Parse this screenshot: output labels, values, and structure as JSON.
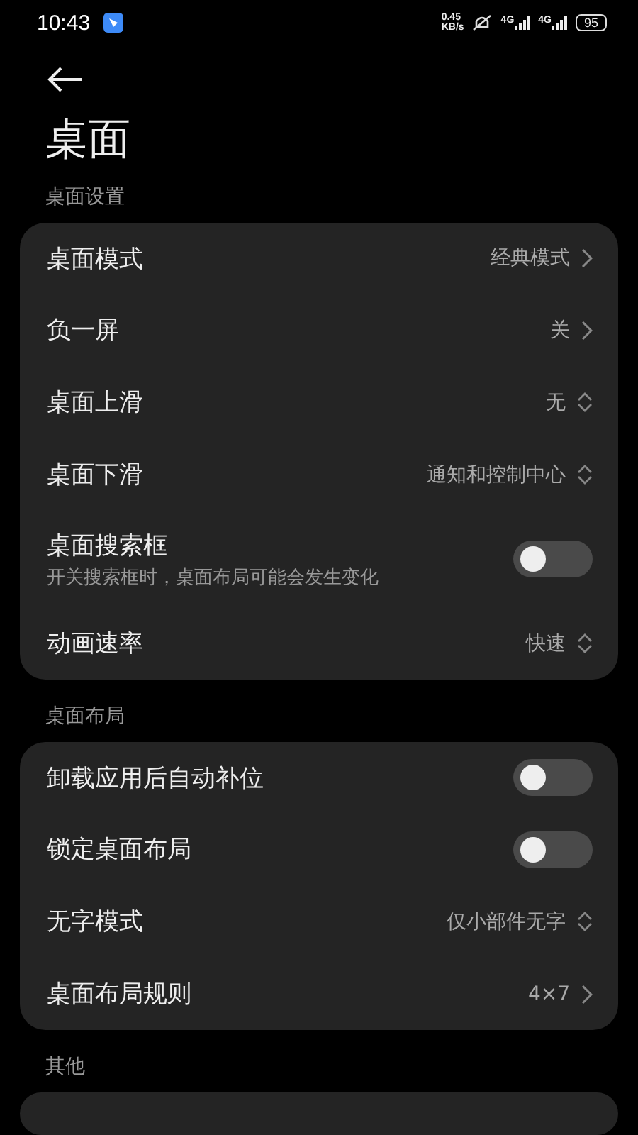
{
  "status_bar": {
    "time": "10:43",
    "speed_value": "0.45",
    "speed_unit": "KB/s",
    "signal_1": "4G",
    "signal_2": "4G",
    "battery": "95"
  },
  "header": {
    "title": "桌面"
  },
  "sections": [
    {
      "label": "桌面设置",
      "rows": [
        {
          "kind": "link",
          "title": "桌面模式",
          "value": "经典模式"
        },
        {
          "kind": "link",
          "title": "负一屏",
          "value": "关"
        },
        {
          "kind": "picker",
          "title": "桌面上滑",
          "value": "无"
        },
        {
          "kind": "picker",
          "title": "桌面下滑",
          "value": "通知和控制中心"
        },
        {
          "kind": "toggle",
          "title": "桌面搜索框",
          "subtitle": "开关搜索框时，桌面布局可能会发生变化",
          "on": false
        },
        {
          "kind": "picker",
          "title": "动画速率",
          "value": "快速"
        }
      ]
    },
    {
      "label": "桌面布局",
      "rows": [
        {
          "kind": "toggle",
          "title": "卸载应用后自动补位",
          "on": false
        },
        {
          "kind": "toggle",
          "title": "锁定桌面布局",
          "on": false
        },
        {
          "kind": "picker",
          "title": "无字模式",
          "value": "仅小部件无字"
        },
        {
          "kind": "link",
          "title": "桌面布局规则",
          "value": "4×7"
        }
      ]
    },
    {
      "label": "其他"
    }
  ]
}
